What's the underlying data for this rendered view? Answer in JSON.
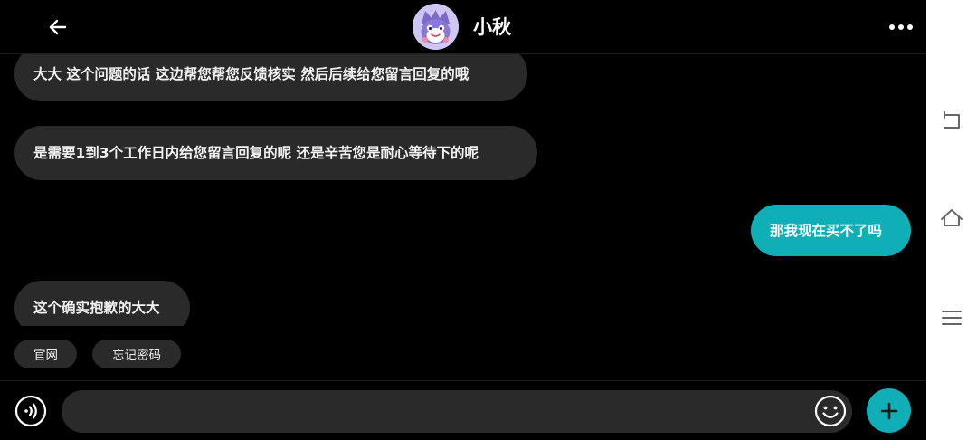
{
  "header": {
    "title": "小秋",
    "back_icon": "arrow-left-icon",
    "more_icon": "more-horizontal-icon",
    "avatar": "cartoon-mascot-avatar"
  },
  "messages": [
    {
      "direction": "in",
      "text": "大大 这个问题的话 这边帮您帮您反馈核实 然后后续给您留言回复的哦"
    },
    {
      "direction": "in",
      "text": "是需要1到3个工作日内给您留言回复的呢 还是辛苦您是耐心等待下的呢"
    },
    {
      "direction": "out",
      "text": "那我现在买不了吗"
    },
    {
      "direction": "in",
      "text": "这个确实抱歉的大大"
    }
  ],
  "quick_replies": [
    "官网",
    "忘记密码"
  ],
  "input": {
    "value": "",
    "placeholder": "",
    "voice_icon": "voice-input-icon",
    "emoji_icon": "emoji-icon",
    "plus_icon": "plus-icon"
  },
  "system_nav": {
    "back_icon": "nav-back-icon",
    "home_icon": "nav-home-icon",
    "menu_icon": "nav-menu-icon"
  },
  "colors": {
    "background": "#000000",
    "bubble_in": "#2a2a2b",
    "bubble_out": "#10aeb6",
    "accent": "#10aeb6",
    "text": "#ffffff"
  }
}
